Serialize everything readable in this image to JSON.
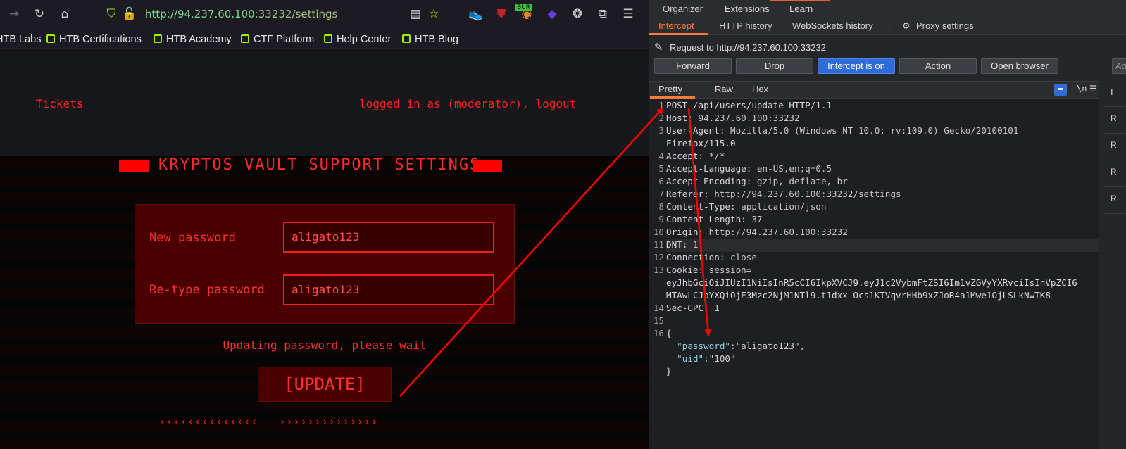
{
  "browser": {
    "url": {
      "host": "http://94.237.60.100",
      "rest": ":33232/settings"
    },
    "bookmarks": [
      "HTB Labs",
      "HTB Certifications",
      "HTB Academy",
      "CTF Platform",
      "Help Center",
      "HTB Blog"
    ],
    "ext_badge": "BUR"
  },
  "site": {
    "nav_tickets": "Tickets",
    "nav_login": "logged in as (moderator), logout",
    "title": "KRYPTOS VAULT SUPPORT SETTINGS",
    "new_password_label": "New password",
    "new_password_value": "aligato123",
    "retype_label": "Re-type password",
    "retype_value": "aligato123",
    "status": "Updating password, please wait",
    "update_button": "[UPDATE]",
    "chevrons": "‹‹‹‹‹‹‹‹‹‹‹‹‹‹   ››››››››››››››"
  },
  "burp": {
    "top_tabs": [
      "Organizer",
      "Extensions",
      "Learn"
    ],
    "sub_tabs": [
      "Intercept",
      "HTTP history",
      "WebSockets history",
      "Proxy settings"
    ],
    "request_to": "Request to http://94.237.60.100:33232",
    "buttons": [
      "Forward",
      "Drop",
      "Intercept is on",
      "Action",
      "Open browser"
    ],
    "partial_button": "Ad",
    "editor_tabs": [
      "Pretty",
      "Raw",
      "Hex"
    ],
    "newline_icon": "\\n",
    "inspector_letter": "I",
    "side_items": [
      "R",
      "R",
      "R",
      "R"
    ],
    "lines": {
      "l1": "POST /api/users/update HTTP/1.1",
      "l2k": "Host:",
      "l2v": " 94.237.60.100:33232",
      "l3k": "User-Agent:",
      "l3v": " Mozilla/5.0 (Windows NT 10.0; rv:109.0) Gecko/20100101",
      "l3b": "Firefox/115.0",
      "l4k": "Accept:",
      "l4v": " */*",
      "l5k": "Accept-Language:",
      "l5v": " en-US,en;q=0.5",
      "l6k": "Accept-Encoding:",
      "l6v": " gzip, deflate, br",
      "l7k": "Referer:",
      "l7v": " http://94.237.60.100:33232/settings",
      "l8k": "Content-Type:",
      "l8v": " application/json",
      "l9k": "Content-Length:",
      "l9v": " 37",
      "l10k": "Origin:",
      "l10v": " http://94.237.60.100:33232",
      "l11k": "DNT:",
      "l11v": " 1",
      "l12k": "Connection:",
      "l12v": " close",
      "l13k": "Cookie:",
      "l13v": " session=",
      "l13b": "eyJhbGciOiJIUzI1NiIsInR5cCI6IkpXVCJ9.eyJ1c2VybmFtZSI6Im1vZGVyYXRvciIsInVpZCI6",
      "l13c": "MTAwLCJpYXQiOjE3Mzc2NjM1NTl9.t1dxx-Ocs1KTVqvrHHb9xZJoR4a1Mwe1OjLSLkNwTK8",
      "l14k": "Sec-GPC:",
      "l14v": " 1",
      "l16": "{",
      "l17k": "  \"password\"",
      "l17v": ":\"aligato123\",",
      "l18k": "  \"uid\"",
      "l18v": ":\"100\"",
      "l19": "}"
    },
    "line_numbers": [
      "1",
      "2",
      "3",
      "4",
      "5",
      "6",
      "7",
      "8",
      "9",
      "10",
      "11",
      "12",
      "13",
      "14",
      "15",
      "16"
    ]
  },
  "colors": {
    "accent_red": "#ff2020",
    "burp_orange": "#ff7a3a",
    "intercept_blue": "#2f6bd9",
    "annotation_arrow": "#ff0000"
  }
}
